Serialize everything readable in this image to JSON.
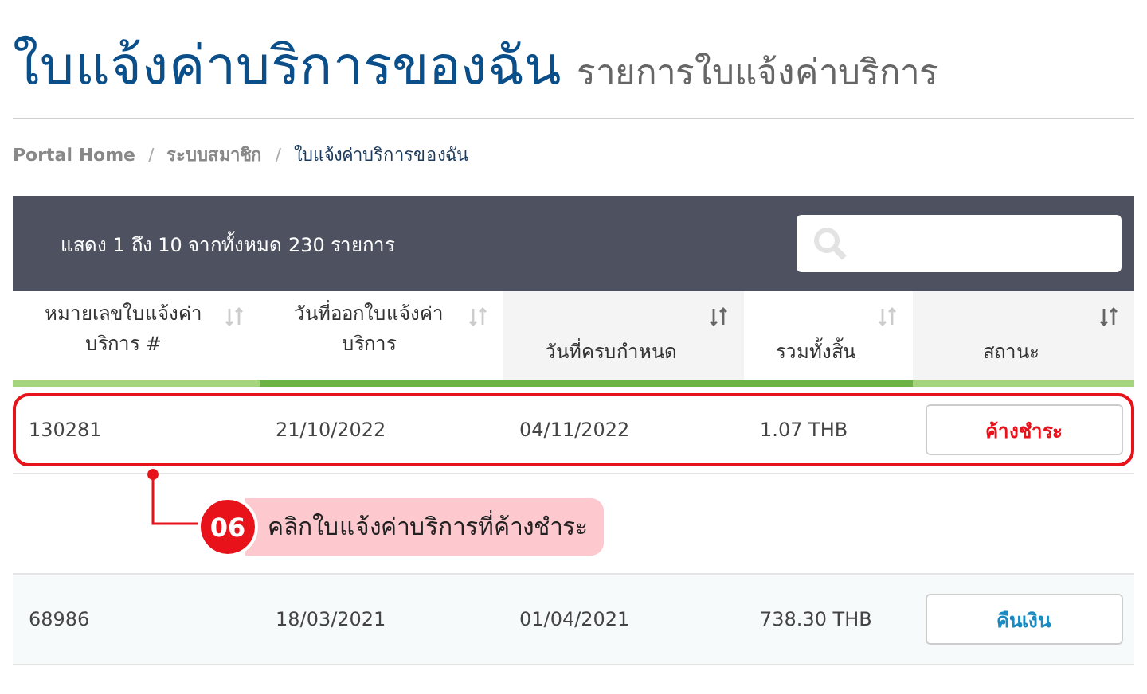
{
  "page_title": "ใบแจ้งค่าบริการของฉัน",
  "page_subtitle": "รายการใบแจ้งค่าบริการ",
  "breadcrumb_separator": "/",
  "breadcrumb": [
    {
      "label": "Portal Home",
      "current": false
    },
    {
      "label": "ระบบสมาชิก",
      "current": false
    },
    {
      "label": "ใบแจ้งค่าบริการของฉัน",
      "current": true
    }
  ],
  "table": {
    "summary": "แสดง 1 ถึง 10 จากทั้งหมด 230 รายการ",
    "columns": [
      {
        "label": "หมายเลขใบแจ้งค่าบริการ #",
        "sorted": false
      },
      {
        "label": "วันที่ออกใบแจ้งค่าบริการ",
        "sorted": false
      },
      {
        "label": "วันที่ครบกำหนด",
        "sorted": true
      },
      {
        "label": "รวมทั้งสิ้น",
        "sorted": false
      },
      {
        "label": "สถานะ",
        "sorted": true
      }
    ],
    "rows": [
      {
        "cells": [
          "130281",
          "21/10/2022",
          "04/11/2022",
          "1.07 THB"
        ],
        "status": {
          "label": "ค้างชำระ",
          "kind": "unpaid"
        },
        "highlighted": true
      },
      {
        "cells": [
          "68986",
          "18/03/2021",
          "01/04/2021",
          "738.30 THB"
        ],
        "status": {
          "label": "คืนเงิน",
          "kind": "refunded"
        },
        "highlighted": false
      }
    ]
  },
  "callout": {
    "number": "06",
    "text": "คลิกใบแจ้งค่าบริการที่ค้างชำระ"
  }
}
